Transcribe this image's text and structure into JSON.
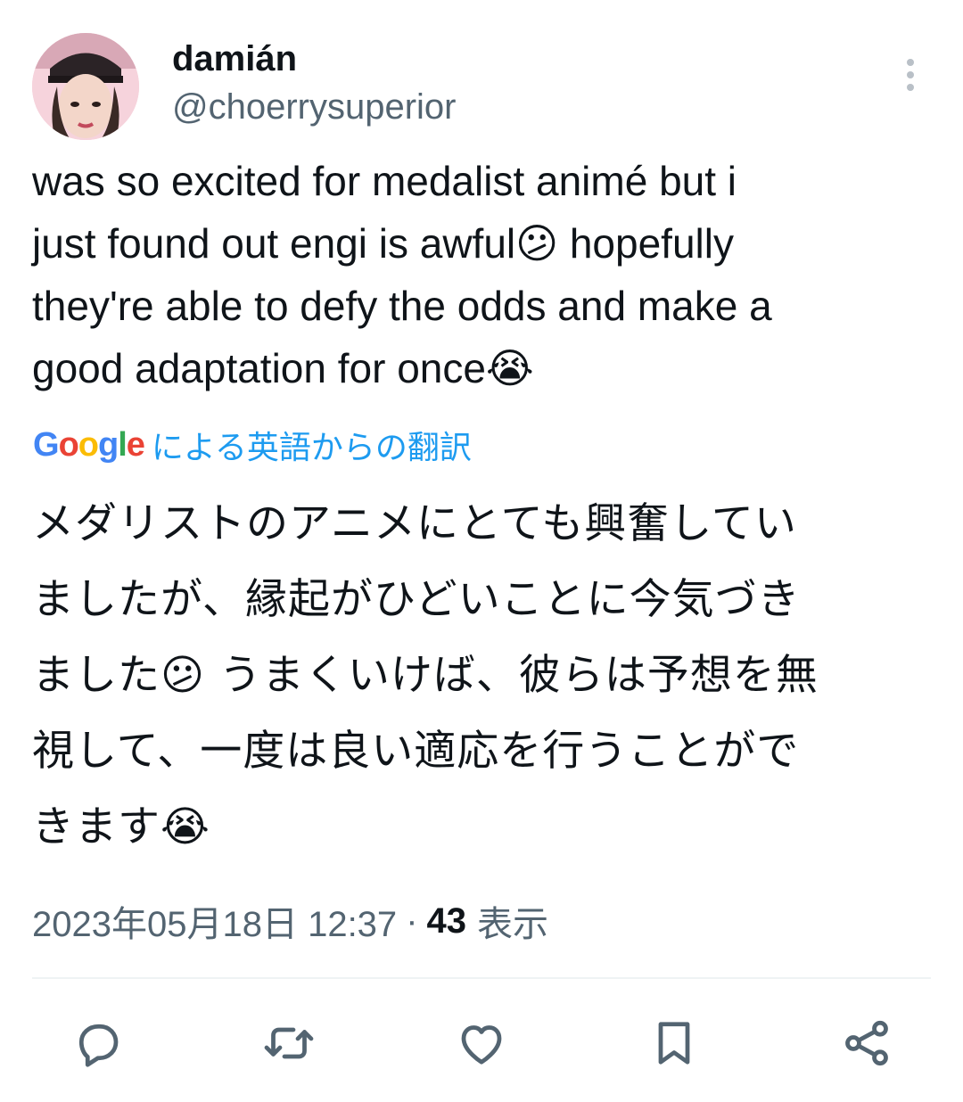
{
  "author": {
    "display_name": "damián",
    "handle": "@choerrysuperior",
    "avatar_icon": "profile-photo"
  },
  "tweet": {
    "text": "was so excited for medalist animé but i\njust found out engi is awful😕 hopefully\nthey're able to defy the odds and make a\ngood adaptation for once😭"
  },
  "translation": {
    "provider": "Google",
    "label": "による英語からの翻訳",
    "text": "メダリストのアニメにとても興奮してい\nましたが、縁起がひどいことに今気づき\nました😕 うまくいけば、彼らは予想を無\n視して、一度は良い適応を行うことがで\nきます😭"
  },
  "meta": {
    "timestamp": "2023年05月18日 12:37",
    "separator": "·",
    "views_count": "43",
    "views_label": "表示"
  },
  "actions": [
    {
      "name": "reply",
      "icon": "reply-icon"
    },
    {
      "name": "retweet",
      "icon": "retweet-icon"
    },
    {
      "name": "like",
      "icon": "heart-icon"
    },
    {
      "name": "bookmark",
      "icon": "bookmark-icon"
    },
    {
      "name": "share",
      "icon": "share-icon"
    }
  ],
  "colors": {
    "text": "#0f1419",
    "secondary": "#536471",
    "link": "#1d9bf0",
    "divider": "#eff3f4"
  }
}
